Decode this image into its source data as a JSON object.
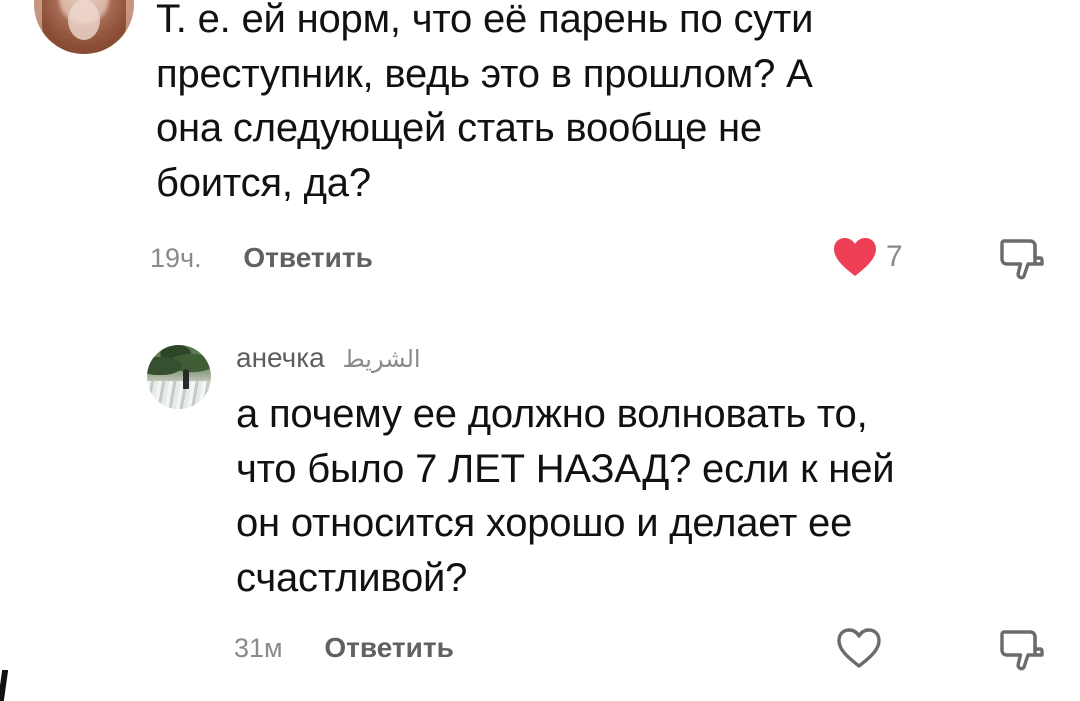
{
  "comments": [
    {
      "author": "",
      "text_lines": [
        "Т. е. ей норм, что её парень по сути",
        "преступник, ведь это в прошлом? А",
        "она следующей стать вообще не",
        "боится, да?"
      ],
      "time": "19ч.",
      "reply_label": "Ответить",
      "likes": "7",
      "liked": true,
      "icons": {
        "like": "heart-filled-icon",
        "dislike": "thumbs-down-icon"
      }
    },
    {
      "author": "анечка",
      "author_badge": "الشريط",
      "text_lines": [
        "а почему ее должно волновать то,",
        "что было 7 ЛЕТ НАЗАД? если к ней",
        "он относится хорошо и делает ее",
        "счастливой?"
      ],
      "time": "31м",
      "reply_label": "Ответить",
      "likes": "",
      "liked": false,
      "icons": {
        "like": "heart-outline-icon",
        "dislike": "thumbs-down-icon"
      }
    }
  ],
  "colors": {
    "like_active": "#ee3f57",
    "icon_outline": "#6b6b6b",
    "secondary_text": "#8a8a8a"
  }
}
